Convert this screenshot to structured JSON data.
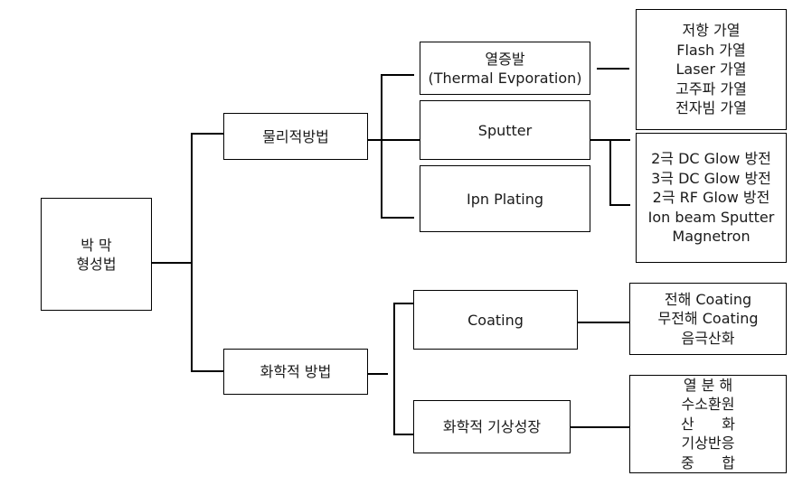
{
  "diagram": {
    "root": {
      "lines": [
        "박 막",
        "형성법"
      ]
    },
    "physical": {
      "label": "물리적방법",
      "children": {
        "thermal": {
          "lines": [
            "열증발",
            "(Thermal Evporation)"
          ]
        },
        "sputter": {
          "lines": [
            "Sputter"
          ]
        },
        "ion_plating": {
          "lines": [
            "Ipn Plating"
          ]
        }
      },
      "thermal_methods": [
        "저항 가열",
        "Flash 가열",
        "Laser 가열",
        "고주파 가열",
        "전자빔 가열"
      ],
      "sputter_methods": [
        "2극 DC Glow 방전",
        "3극 DC Glow 방전",
        "2극 RF Glow 방전",
        "Ion beam Sputter",
        "Magnetron"
      ]
    },
    "chemical": {
      "label": "화학적 방법",
      "children": {
        "coating": {
          "lines": [
            "Coating"
          ]
        },
        "cvd": {
          "lines": [
            "화학적 기상성장"
          ]
        }
      },
      "coating_methods": [
        "전해 Coating",
        "무전해 Coating",
        "음극산화"
      ],
      "cvd_methods": [
        "열 분 해",
        "수소환원",
        "산      화",
        "기상반응",
        "중      합"
      ]
    }
  }
}
